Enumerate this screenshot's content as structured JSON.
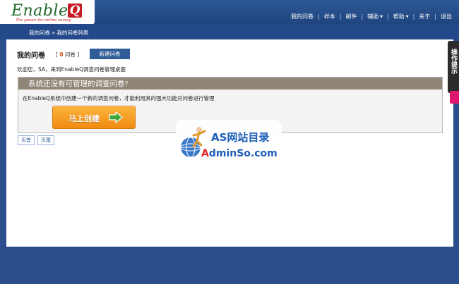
{
  "app": {
    "logo_text": "Enable",
    "logo_q": "Q",
    "logo_tagline": "The power for online survey"
  },
  "topnav": {
    "items": [
      {
        "label": "我的问卷"
      },
      {
        "label": "样本"
      },
      {
        "label": "邮件"
      },
      {
        "label": "辅助",
        "dropdown": true
      },
      {
        "label": "帮助",
        "dropdown": true
      },
      {
        "label": "关于"
      },
      {
        "label": "退出"
      }
    ]
  },
  "breadcrumb": {
    "home": "我的问卷",
    "separator": "»",
    "current": "我的问卷列表"
  },
  "main": {
    "heading": "我的问卷",
    "count_open": "[",
    "count_value": "0",
    "count_unit": "问卷",
    "count_close": "]",
    "new_button": "新建问卷",
    "welcome": "欢迎您，SA，来到EnableQ调查问卷管理桌面"
  },
  "notice": {
    "title": "系统还没有可管理的调查问卷",
    "title_mark": "?",
    "description": "在EnableQ系统中创建一个新的调查问卷，才能利用其的强大功能对问卷进行管理",
    "create_button": "马上创建"
  },
  "pager": {
    "first": "页首",
    "last": "页尾"
  },
  "side_tab": {
    "label": "操作提示"
  },
  "watermark": {
    "line1": "AS网站目录",
    "line2_a": "A",
    "line2_b": "dminSo.com"
  },
  "colors": {
    "page_bg": "#2a4f8c",
    "header_bg": "#2d5896",
    "brand_green": "#1d6a2a",
    "brand_red": "#c51b22",
    "button_blue": "#2f5b96",
    "notice_head": "#8f8678",
    "create_orange": "#f39a1e",
    "arrow_green": "#3aa53a",
    "side_tab": "#2b2b2b",
    "side_accent": "#e0176f"
  },
  "icons": {
    "caret": "caret-down-icon",
    "arrow": "arrow-right-icon",
    "globe": "globe-person-icon"
  }
}
